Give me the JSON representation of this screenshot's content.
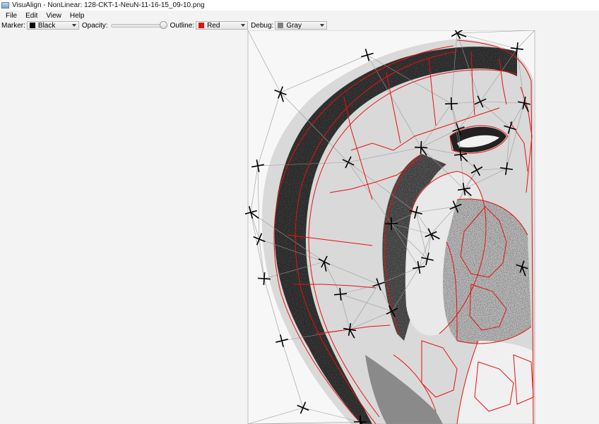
{
  "window": {
    "title": "VisuAlign - NonLinear: 128-CKT-1-NeuN-11-16-15_09-10.png"
  },
  "menu": {
    "items": [
      "File",
      "Edit",
      "View",
      "Help"
    ]
  },
  "toolbar": {
    "marker_label": "Marker:",
    "marker_value": "Black",
    "marker_color": "#000000",
    "opacity_label": "Opacity:",
    "opacity_value": 1.0,
    "outline_label": "Outline:",
    "outline_value": "Red",
    "outline_color": "#e81010",
    "debug_label": "Debug:",
    "debug_value": "Gray",
    "debug_color": "#808080"
  },
  "canvas": {
    "image_name": "128-CKT-1-NeuN-11-16-15_09-10.png",
    "marker_count": 34,
    "atlas_outline_color": "#e81010",
    "triangulation_color": "#9a9a9a",
    "marker_color": "#000000"
  }
}
